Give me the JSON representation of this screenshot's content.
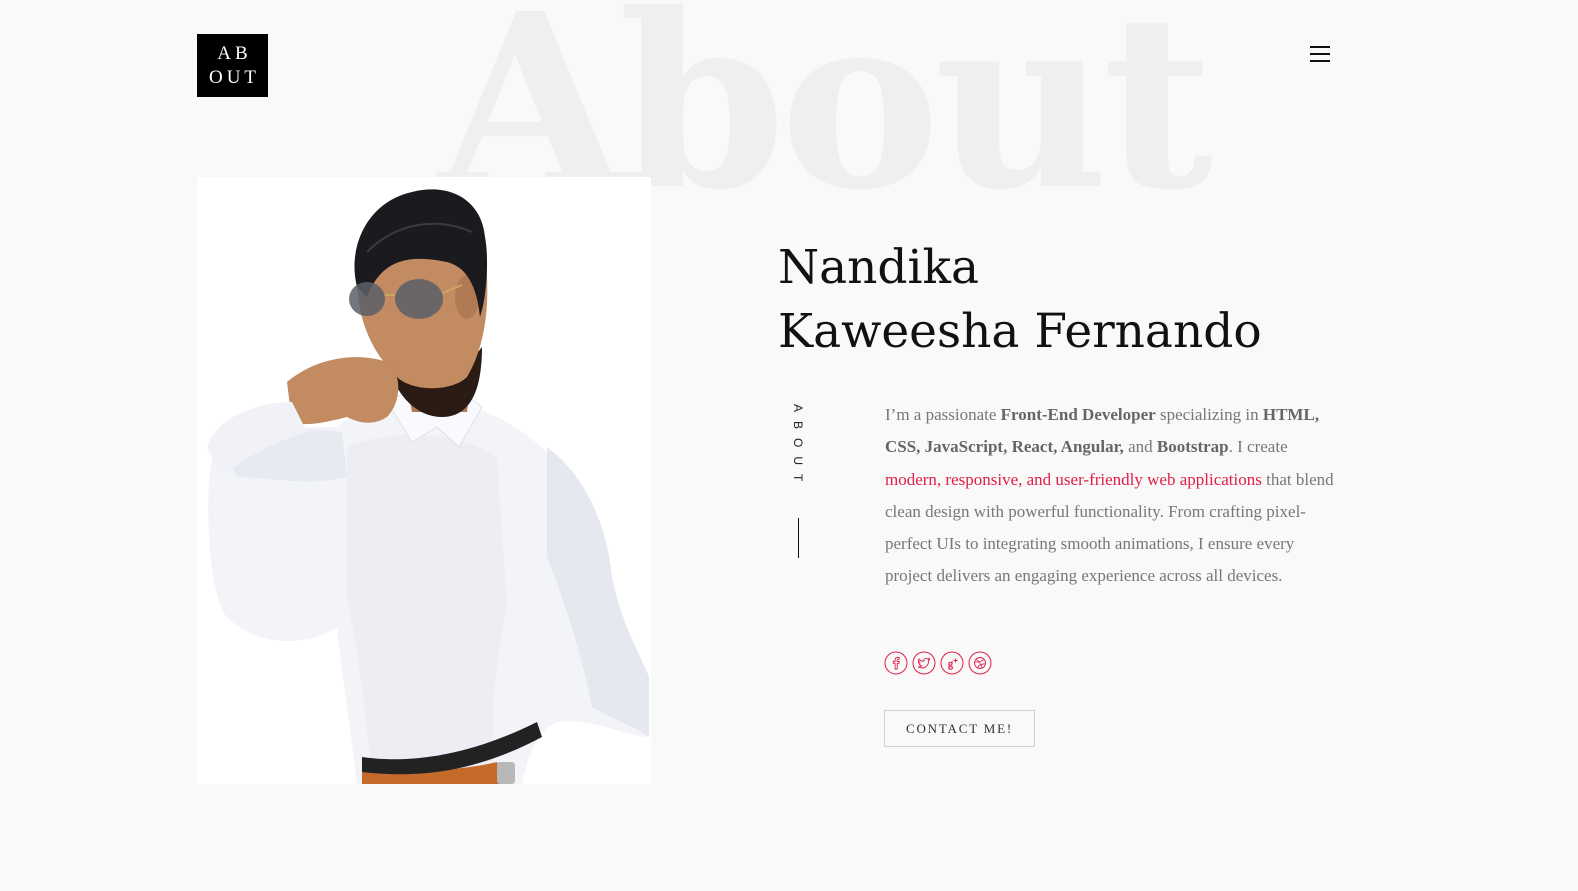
{
  "header": {
    "logo_line1": "AB",
    "logo_line2": "OUT",
    "menu_icon": "hamburger-menu-icon"
  },
  "hero": {
    "background_word": "About",
    "name_line1": "Nandika",
    "name_line2": "Kaweesha Fernando",
    "side_label": "ABOUT"
  },
  "bio": {
    "t1": "I’m a passionate ",
    "b1": "Front-End Developer",
    "t2": " specializing in ",
    "b2": "HTML, CSS, JavaScript, React, Angular,",
    "t3": " and ",
    "b3": "Bootstrap",
    "t4": ". I create ",
    "highlight": "modern, responsive, and user-friendly web applications",
    "t5": " that blend clean design with powerful functionality. From crafting pixel-perfect UIs to integrating smooth animations, I ensure every project delivers an engaging experience across all devices."
  },
  "socials": [
    {
      "name": "facebook",
      "icon": "facebook-icon"
    },
    {
      "name": "twitter",
      "icon": "twitter-icon"
    },
    {
      "name": "google-plus",
      "icon": "google-plus-icon"
    },
    {
      "name": "dribbble",
      "icon": "dribbble-icon"
    }
  ],
  "contact_button": "CONTACT ME!",
  "colors": {
    "accent": "#e11d48",
    "background": "#f9f9f9",
    "logo_bg": "#000000",
    "text_muted": "#777777",
    "watermark": "#efefef"
  }
}
